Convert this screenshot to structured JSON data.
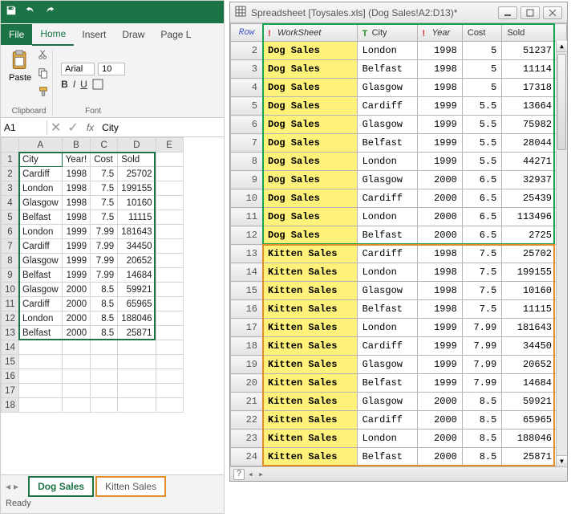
{
  "excel": {
    "ribbon": {
      "tabs": {
        "file": "File",
        "home": "Home",
        "insert": "Insert",
        "draw": "Draw",
        "page": "Page L"
      },
      "clipboard": {
        "paste": "Paste",
        "label": "Clipboard"
      },
      "font": {
        "name": "Arial",
        "size": "10",
        "label": "Font",
        "bold": "B",
        "italic": "I",
        "underline": "U"
      }
    },
    "namebox": "A1",
    "formula": "City",
    "columns": [
      "A",
      "B",
      "C",
      "D",
      "E"
    ],
    "headers": {
      "city": "City",
      "year": "Year!",
      "cost": "Cost",
      "sold": "Sold"
    },
    "rows": [
      {
        "city": "Cardiff",
        "year": 1998,
        "cost": 7.5,
        "sold": 25702
      },
      {
        "city": "London",
        "year": 1998,
        "cost": 7.5,
        "sold": 199155
      },
      {
        "city": "Glasgow",
        "year": 1998,
        "cost": 7.5,
        "sold": 10160
      },
      {
        "city": "Belfast",
        "year": 1998,
        "cost": 7.5,
        "sold": 11115
      },
      {
        "city": "London",
        "year": 1999,
        "cost": 7.99,
        "sold": 181643
      },
      {
        "city": "Cardiff",
        "year": 1999,
        "cost": 7.99,
        "sold": 34450
      },
      {
        "city": "Glasgow",
        "year": 1999,
        "cost": 7.99,
        "sold": 20652
      },
      {
        "city": "Belfast",
        "year": 1999,
        "cost": 7.99,
        "sold": 14684
      },
      {
        "city": "Glasgow",
        "year": 2000,
        "cost": 8.5,
        "sold": 59921
      },
      {
        "city": "Cardiff",
        "year": 2000,
        "cost": 8.5,
        "sold": 65965
      },
      {
        "city": "London",
        "year": 2000,
        "cost": 8.5,
        "sold": 188046
      },
      {
        "city": "Belfast",
        "year": 2000,
        "cost": 8.5,
        "sold": 25871
      }
    ],
    "empty_rows": [
      14,
      15,
      16,
      17,
      18
    ],
    "sheet_tabs": {
      "dog": "Dog Sales",
      "kitten": "Kitten Sales"
    },
    "status": "Ready"
  },
  "rpanel": {
    "title": "Spreadsheet [Toysales.xls] (Dog Sales!A2:D13)*",
    "headers": {
      "row": "Row",
      "ws": "WorkSheet",
      "city": "City",
      "year": "Year",
      "cost": "Cost",
      "sold": "Sold"
    },
    "rows": [
      {
        "n": 2,
        "ws": "Dog Sales",
        "city": "London",
        "year": 1998,
        "cost": 5,
        "sold": 51237
      },
      {
        "n": 3,
        "ws": "Dog Sales",
        "city": "Belfast",
        "year": 1998,
        "cost": 5,
        "sold": 11114
      },
      {
        "n": 4,
        "ws": "Dog Sales",
        "city": "Glasgow",
        "year": 1998,
        "cost": 5,
        "sold": 17318
      },
      {
        "n": 5,
        "ws": "Dog Sales",
        "city": "Cardiff",
        "year": 1999,
        "cost": 5.5,
        "sold": 13664
      },
      {
        "n": 6,
        "ws": "Dog Sales",
        "city": "Glasgow",
        "year": 1999,
        "cost": 5.5,
        "sold": 75982
      },
      {
        "n": 7,
        "ws": "Dog Sales",
        "city": "Belfast",
        "year": 1999,
        "cost": 5.5,
        "sold": 28044
      },
      {
        "n": 8,
        "ws": "Dog Sales",
        "city": "London",
        "year": 1999,
        "cost": 5.5,
        "sold": 44271
      },
      {
        "n": 9,
        "ws": "Dog Sales",
        "city": "Glasgow",
        "year": 2000,
        "cost": 6.5,
        "sold": 32937
      },
      {
        "n": 10,
        "ws": "Dog Sales",
        "city": "Cardiff",
        "year": 2000,
        "cost": 6.5,
        "sold": 25439
      },
      {
        "n": 11,
        "ws": "Dog Sales",
        "city": "London",
        "year": 2000,
        "cost": 6.5,
        "sold": 113496
      },
      {
        "n": 12,
        "ws": "Dog Sales",
        "city": "Belfast",
        "year": 2000,
        "cost": 6.5,
        "sold": 2725
      },
      {
        "n": 13,
        "ws": "Kitten Sales",
        "city": "Cardiff",
        "year": 1998,
        "cost": 7.5,
        "sold": 25702
      },
      {
        "n": 14,
        "ws": "Kitten Sales",
        "city": "London",
        "year": 1998,
        "cost": 7.5,
        "sold": 199155
      },
      {
        "n": 15,
        "ws": "Kitten Sales",
        "city": "Glasgow",
        "year": 1998,
        "cost": 7.5,
        "sold": 10160
      },
      {
        "n": 16,
        "ws": "Kitten Sales",
        "city": "Belfast",
        "year": 1998,
        "cost": 7.5,
        "sold": 11115
      },
      {
        "n": 17,
        "ws": "Kitten Sales",
        "city": "London",
        "year": 1999,
        "cost": 7.99,
        "sold": 181643
      },
      {
        "n": 18,
        "ws": "Kitten Sales",
        "city": "Cardiff",
        "year": 1999,
        "cost": 7.99,
        "sold": 34450
      },
      {
        "n": 19,
        "ws": "Kitten Sales",
        "city": "Glasgow",
        "year": 1999,
        "cost": 7.99,
        "sold": 20652
      },
      {
        "n": 20,
        "ws": "Kitten Sales",
        "city": "Belfast",
        "year": 1999,
        "cost": 7.99,
        "sold": 14684
      },
      {
        "n": 21,
        "ws": "Kitten Sales",
        "city": "Glasgow",
        "year": 2000,
        "cost": 8.5,
        "sold": 59921
      },
      {
        "n": 22,
        "ws": "Kitten Sales",
        "city": "Cardiff",
        "year": 2000,
        "cost": 8.5,
        "sold": 65965
      },
      {
        "n": 23,
        "ws": "Kitten Sales",
        "city": "London",
        "year": 2000,
        "cost": 8.5,
        "sold": 188046
      },
      {
        "n": 24,
        "ws": "Kitten Sales",
        "city": "Belfast",
        "year": 2000,
        "cost": 8.5,
        "sold": 25871
      }
    ],
    "footer_help": "?"
  }
}
